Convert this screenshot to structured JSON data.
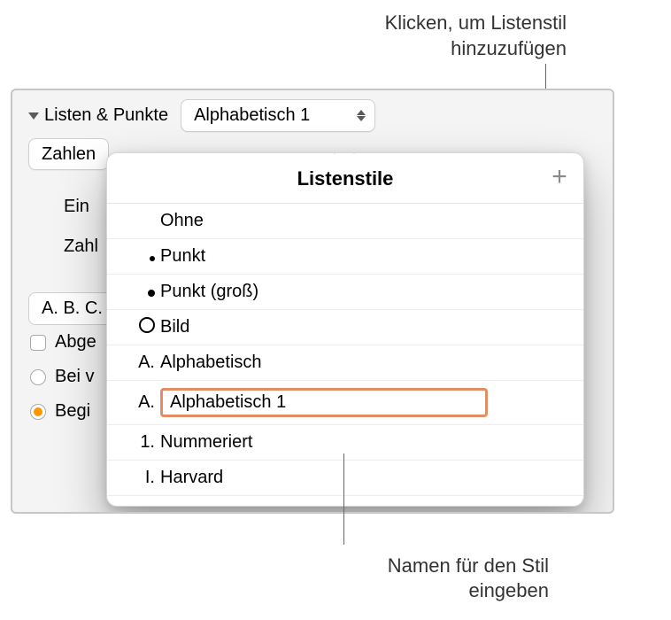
{
  "annotations": {
    "top": "Klicken, um Listenstil hinzuzufügen",
    "bottom": "Namen für den Stil eingeben"
  },
  "sidebar": {
    "section_title": "Listen & Punkte",
    "style_dropdown_value": "Alphabetisch 1",
    "numbers_button": "Zahlen",
    "indent_label": "Ein",
    "number_label": "Zahl",
    "format_preview": "A. B. C.",
    "checkbox_label": "Abge",
    "radio1_label": "Bei v",
    "radio2_label": "Begi"
  },
  "popover": {
    "title": "Listenstile",
    "add_glyph": "+",
    "items": [
      {
        "prefix_type": "none",
        "prefix_text": "",
        "label": "Ohne"
      },
      {
        "prefix_type": "dot",
        "prefix_text": "",
        "label": "Punkt"
      },
      {
        "prefix_type": "bigdot",
        "prefix_text": "",
        "label": "Punkt (groß)"
      },
      {
        "prefix_type": "ring",
        "prefix_text": "",
        "label": "Bild"
      },
      {
        "prefix_type": "text",
        "prefix_text": "A.",
        "label": "Alphabetisch"
      },
      {
        "prefix_type": "text",
        "prefix_text": "A.",
        "label": "Alphabetisch 1",
        "editing": true
      },
      {
        "prefix_type": "text",
        "prefix_text": "1.",
        "label": "Nummeriert"
      },
      {
        "prefix_type": "text",
        "prefix_text": "I.",
        "label": "Harvard"
      }
    ]
  }
}
